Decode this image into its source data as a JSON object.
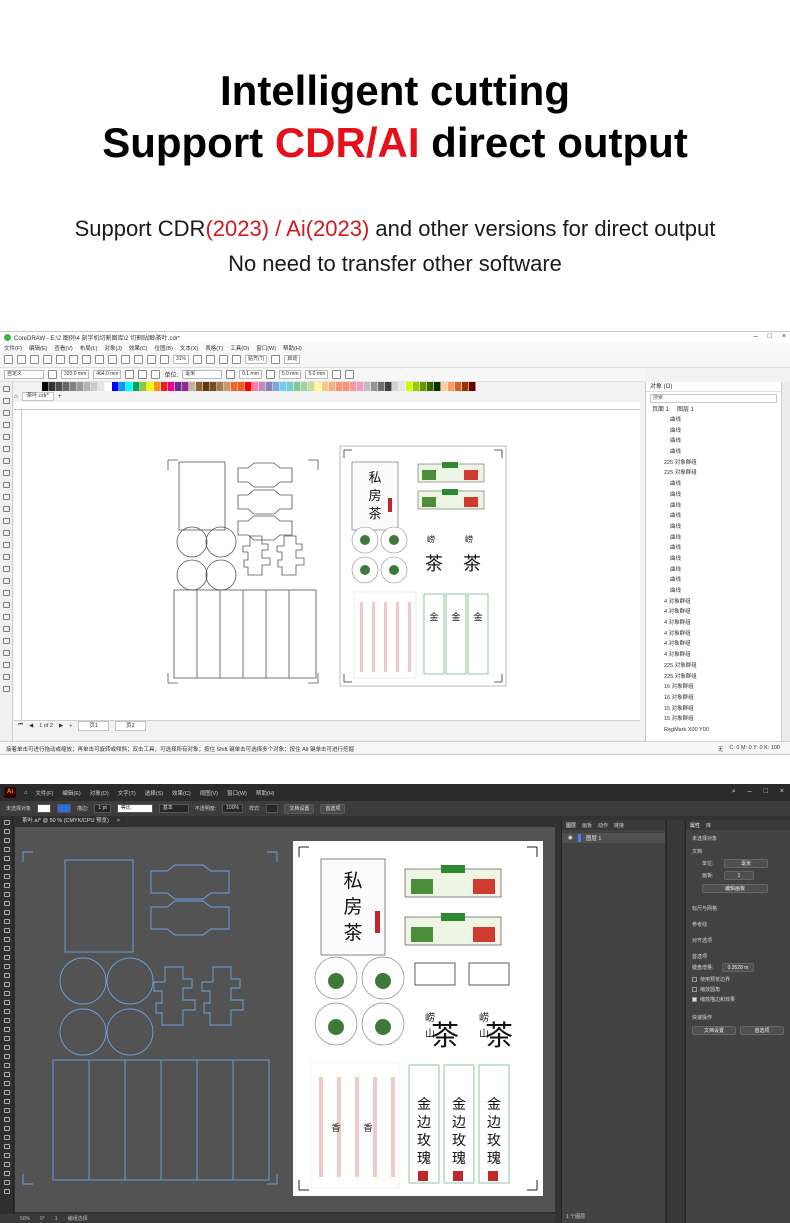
{
  "header": {
    "line1": "Intelligent cutting",
    "line2_a": "Support ",
    "line2_b": "CDR/AI",
    "line2_c": " direct output",
    "sub1_a": "Support CDR",
    "sub1_b": "(2023) / Ai(2023)",
    "sub1_c": " and other versions for direct output",
    "sub2": "No need to transfer other software"
  },
  "coreldraw": {
    "title": "CoreDRAW - E:\\2 图例\\4 刻字机切割图库\\2 切割贴图\\茶叶.cdr*",
    "menu": [
      "文件(F)",
      "编辑(E)",
      "查看(V)",
      "布局(L)",
      "对象(J)",
      "效果(C)",
      "位图(B)",
      "文本(X)",
      "表格(T)",
      "工具(O)",
      "窗口(W)",
      "帮助(H)"
    ],
    "zoom": "31%",
    "snap_label": "贴齐(T)",
    "launch_label": "启动",
    "font_name": "自定义",
    "width_field": "320.0 mm",
    "height_field": "464.0 mm",
    "unit_label": "单位:",
    "unit_value": "毫米",
    "nudge": "0.1 mm",
    "dup_x": "5.0 mm",
    "dup_y": "5.0 mm",
    "doc_tab": "茶叶.cdr*",
    "page_nav": "1 of 2",
    "page_tabs": [
      "页1",
      "页2"
    ],
    "status_text": "接着单击可进行拖动或缩放；再单击可旋转或倾斜；双击工具，可选择所有对象；按住 Shift 键单击可选择多个对象；按住 Alt 键单击可进行挖掘",
    "status_fill": "无",
    "status_cmyk": "C: 0 M: 0 Y: 0 K: 100",
    "objects_panel": {
      "title": "对象 (O)",
      "search": "搜索",
      "page": "页面 1",
      "layer": "图层 1",
      "items": [
        {
          "label": "曲线",
          "depth": 2
        },
        {
          "label": "曲线",
          "depth": 2
        },
        {
          "label": "曲线",
          "depth": 2
        },
        {
          "label": "曲线",
          "depth": 2
        },
        {
          "label": "225 对象群组",
          "depth": 1
        },
        {
          "label": "225 对象群组",
          "depth": 1
        },
        {
          "label": "曲线",
          "depth": 2
        },
        {
          "label": "曲线",
          "depth": 2
        },
        {
          "label": "曲线",
          "depth": 2
        },
        {
          "label": "曲线",
          "depth": 2
        },
        {
          "label": "曲线",
          "depth": 2
        },
        {
          "label": "曲线",
          "depth": 2
        },
        {
          "label": "曲线",
          "depth": 2
        },
        {
          "label": "曲线",
          "depth": 2
        },
        {
          "label": "曲线",
          "depth": 2
        },
        {
          "label": "曲线",
          "depth": 2
        },
        {
          "label": "曲线",
          "depth": 2
        },
        {
          "label": "4 对象群组",
          "depth": 1
        },
        {
          "label": "4 对象群组",
          "depth": 1
        },
        {
          "label": "4 对象群组",
          "depth": 1
        },
        {
          "label": "4 对象群组",
          "depth": 1
        },
        {
          "label": "4 对象群组",
          "depth": 1
        },
        {
          "label": "4 对象群组",
          "depth": 1
        },
        {
          "label": "225 对象群组",
          "depth": 1
        },
        {
          "label": "225 对象群组",
          "depth": 1
        },
        {
          "label": "16 对象群组",
          "depth": 1
        },
        {
          "label": "16 对象群组",
          "depth": 1
        },
        {
          "label": "15 对象群组",
          "depth": 1
        },
        {
          "label": "15 对象群组",
          "depth": 1
        },
        {
          "label": "RegMark X00 Y00",
          "depth": 1
        }
      ]
    },
    "palette": [
      "#000000",
      "#333333",
      "#4d4d4d",
      "#666666",
      "#808080",
      "#999999",
      "#b3b3b3",
      "#cccccc",
      "#e6e6e6",
      "#ffffff",
      "#0000ff",
      "#00a0e9",
      "#00ffff",
      "#00a651",
      "#8dc63f",
      "#fff200",
      "#f7941d",
      "#ed1c24",
      "#ec008c",
      "#662d91",
      "#92278f",
      "#c7b299",
      "#8c6239",
      "#603913",
      "#754c24",
      "#a67c52",
      "#c69c6d",
      "#f26522",
      "#f15a24",
      "#ff0000",
      "#ff7bac",
      "#bd8cbf",
      "#8781bd",
      "#7da7d9",
      "#6dcff6",
      "#7accc8",
      "#82ca9c",
      "#a3d39c",
      "#c4df9b",
      "#fff799",
      "#fdc68a",
      "#f9ad81",
      "#f7977a",
      "#f69679",
      "#f6989d",
      "#f49ac1",
      "#bcbec0",
      "#939598",
      "#6d6e71",
      "#414042",
      "#d1d3d4",
      "#e6e7e8",
      "#ccff00",
      "#99cc00",
      "#669900",
      "#336600",
      "#003300",
      "#ffcc99",
      "#ff9966",
      "#cc6633",
      "#993300",
      "#660000"
    ]
  },
  "illustrator": {
    "logo": "Ai",
    "menu": [
      "文件(F)",
      "编辑(E)",
      "对象(O)",
      "文字(T)",
      "选择(S)",
      "效果(C)",
      "视图(V)",
      "窗口(W)",
      "帮助(H)"
    ],
    "control": {
      "no_selection": "未选择对象",
      "stroke_label": "描边:",
      "stroke_weight": "1 pt",
      "stroke_style": "等比",
      "brush": "基本",
      "opacity_label": "不透明度:",
      "opacity_value": "100%",
      "style_label": "样式:",
      "doc_setup": "文档设置",
      "prefs": "首选项"
    },
    "doc_tab": "茶叶.ai* @ 50 % (CMYK/CPU 预览)",
    "status": {
      "zoom": "50%",
      "angle": "0°",
      "artboard": "1",
      "tool": "编组选择"
    },
    "layers_panel": {
      "tabs": [
        "图层",
        "画板",
        "动作",
        "链接"
      ],
      "layer_name": "图层 1",
      "footer": "1 个图层"
    },
    "properties_panel": {
      "tabs": [
        "属性",
        "库"
      ],
      "no_selection": "未选择对象",
      "doc_section": "文档",
      "units_label": "单位:",
      "units_value": "毫米",
      "artboard_label": "画板:",
      "artboard_value": "1",
      "edit_artboard": "编辑画板",
      "ruler_grid": "标尺与网格",
      "guides": "参考线",
      "align": "对齐选项",
      "preferences": "首选项",
      "nudge_label": "键盘增量:",
      "nudge_value": "0.3528 m",
      "check1": "使用预览边界",
      "check2": "缩放圆角",
      "check3": "缩放描边和效果",
      "quick_actions": "快速操作",
      "doc_setup_btn": "文档设置",
      "prefs_btn": "首选项"
    }
  }
}
